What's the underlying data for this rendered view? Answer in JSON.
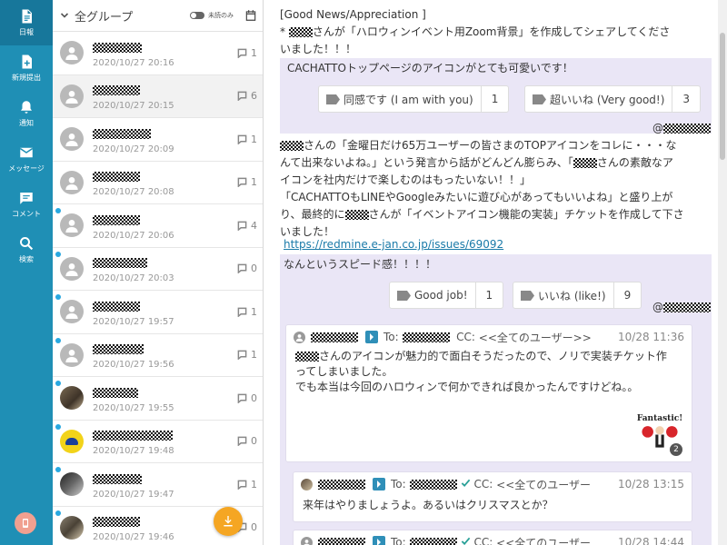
{
  "sidebar": {
    "items": [
      {
        "label": "日報",
        "icon": "document-icon"
      },
      {
        "label": "新規提出",
        "icon": "new-doc-icon"
      },
      {
        "label": "通知",
        "icon": "bell-icon"
      },
      {
        "label": "メッセージ",
        "icon": "mail-icon"
      },
      {
        "label": "コメント",
        "icon": "comment-icon"
      },
      {
        "label": "検索",
        "icon": "search-icon"
      }
    ],
    "active_index": 0,
    "bottom_icon": "phone-icon"
  },
  "list": {
    "group_title": "全グループ",
    "unread_toggle_label": "未読のみ",
    "rows": [
      {
        "time": "2020/10/27 20:16",
        "count": "1"
      },
      {
        "time": "2020/10/27 20:15",
        "count": "6"
      },
      {
        "time": "2020/10/27 20:09",
        "count": "1"
      },
      {
        "time": "2020/10/27 20:08",
        "count": "1"
      },
      {
        "time": "2020/10/27 20:06",
        "count": "4"
      },
      {
        "time": "2020/10/27 20:03",
        "count": "0"
      },
      {
        "time": "2020/10/27 19:57",
        "count": "1"
      },
      {
        "time": "2020/10/27 19:56",
        "count": "1"
      },
      {
        "time": "2020/10/27 19:55",
        "count": "0"
      },
      {
        "time": "2020/10/27 19:48",
        "count": "0"
      },
      {
        "time": "2020/10/27 19:47",
        "count": "1"
      },
      {
        "time": "2020/10/27 19:46",
        "count": "0"
      }
    ]
  },
  "thread": {
    "heading": "[Good News/Appreciation ]",
    "intro_line1": "* ",
    "intro_line1_rest": "さんが「ハロウィンイベント用Zoom背景」を作成してシェアしてくださ",
    "intro_line2": "いました！！！",
    "block1_text": "CACHATTOトップページのアイコンがとても可愛いです！",
    "reactions1": [
      {
        "label": "同感です (I am with you)",
        "count": "1"
      },
      {
        "label": "超いいね (Very good!)",
        "count": "3"
      }
    ],
    "mention_prefix": "@",
    "para2_line1": "さんの「金曜日だけ65万ユーザーの皆さまのTOPアイコンをコレに・・・な",
    "para2_line2": "んて出来ないよね。」という発言から話がどんどん膨らみ、「",
    "para2_line2_rest": "さんの素敵なア",
    "para2_line3": "イコンを社内だけで楽しむのはもったいない！！」",
    "para2_line4": "「CACHATTOもLINEやGoogleみたいに遊び心があってもいいよね」と盛り上が",
    "para2_line5": "り、最終的に",
    "para2_line5_rest": "さんが「イベントアイコン機能の実装」チケットを作成して下さ",
    "para2_line6": "いました！",
    "link": "https://redmine.e-jan.co.jp/issues/69092",
    "block2_text": "なんというスピード感！！！！",
    "reactions2": [
      {
        "label": "Good job!",
        "count": "1"
      },
      {
        "label": "いいね (like!)",
        "count": "9"
      }
    ],
    "comments": [
      {
        "to_label": "To:",
        "cc_label": "CC:",
        "cc_value": "<<全てのユーザー>>",
        "time": "10/28 11:36",
        "body_line1_rest": "さんのアイコンが魅力的で面白そうだったので、ノリで実装チケット作",
        "body_line2": "ってしまいました。",
        "body_line3": "でも本当は今回のハロウィンで何かできれば良かったんですけどね。。",
        "sticker_text": "Fantastic!",
        "sticker_count": "2"
      },
      {
        "to_label": "To:",
        "cc_label": "CC:",
        "cc_value": "<<全てのユーザー",
        "time": "10/28 13:15",
        "body_line1": "来年はやりましょうよ。あるいはクリスマスとか？"
      },
      {
        "to_label": "To:",
        "cc_label": "CC:",
        "cc_value": "<<全てのユーザー",
        "time": "10/28 14:44"
      }
    ]
  },
  "colors": {
    "sidebar": "#1f8fb5",
    "accent": "#29a8e0",
    "highlight_bg": "#eae6f6",
    "fab": "#f5a623"
  }
}
